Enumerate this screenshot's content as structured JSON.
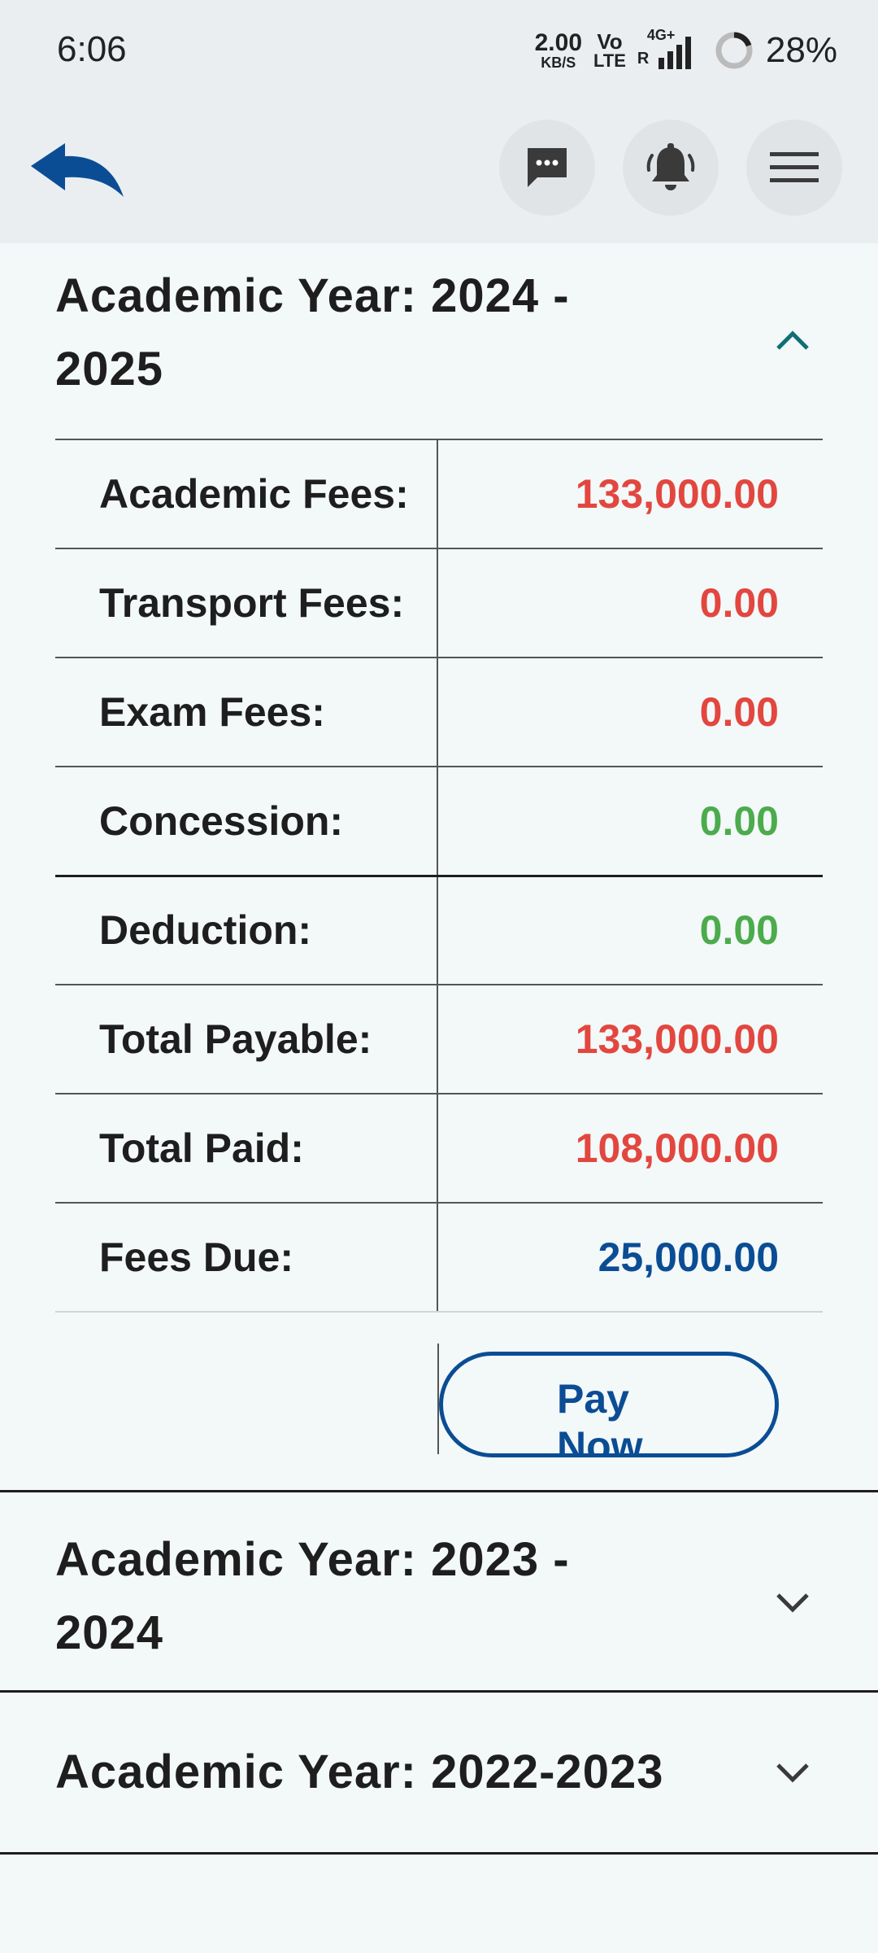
{
  "status_bar": {
    "time": "6:06",
    "net_speed_value": "2.00",
    "net_speed_unit": "KB/S",
    "volte_top": "Vo",
    "volte_bottom": "LTE",
    "network_type": "4G+",
    "roaming": "R",
    "battery_percent": "28%"
  },
  "app_bar": {
    "icons": [
      "back-arrow-icon",
      "chat-icon",
      "bell-icon",
      "menu-icon"
    ]
  },
  "years": [
    {
      "title": "Academic Year: 2024 - 2025",
      "expanded": true,
      "fees": [
        {
          "label": "Academic Fees:",
          "value": "133,000.00",
          "color": "#e2473f"
        },
        {
          "label": "Transport Fees:",
          "value": "0.00",
          "color": "#e2473f"
        },
        {
          "label": "Exam Fees:",
          "value": "0.00",
          "color": "#e2473f"
        },
        {
          "label": "Concession:",
          "value": "0.00",
          "color": "#4cab4c"
        },
        {
          "label": "Deduction:",
          "value": "0.00",
          "color": "#4cab4c"
        },
        {
          "label": "Total Payable:",
          "value": "133,000.00",
          "color": "#e2473f"
        },
        {
          "label": "Total Paid:",
          "value": "108,000.00",
          "color": "#e2473f"
        },
        {
          "label": "Fees Due:",
          "value": "25,000.00",
          "color": "#0b4d94"
        }
      ],
      "pay_button_label": "Pay Now"
    },
    {
      "title": "Academic Year: 2023 - 2024",
      "expanded": false
    },
    {
      "title": "Academic Year: 2022-2023",
      "expanded": false
    }
  ],
  "colors": {
    "accent_blue": "#0b4d94",
    "amount_red": "#e2473f",
    "amount_green": "#4cab4c",
    "chevron_teal": "#0f6f74"
  }
}
